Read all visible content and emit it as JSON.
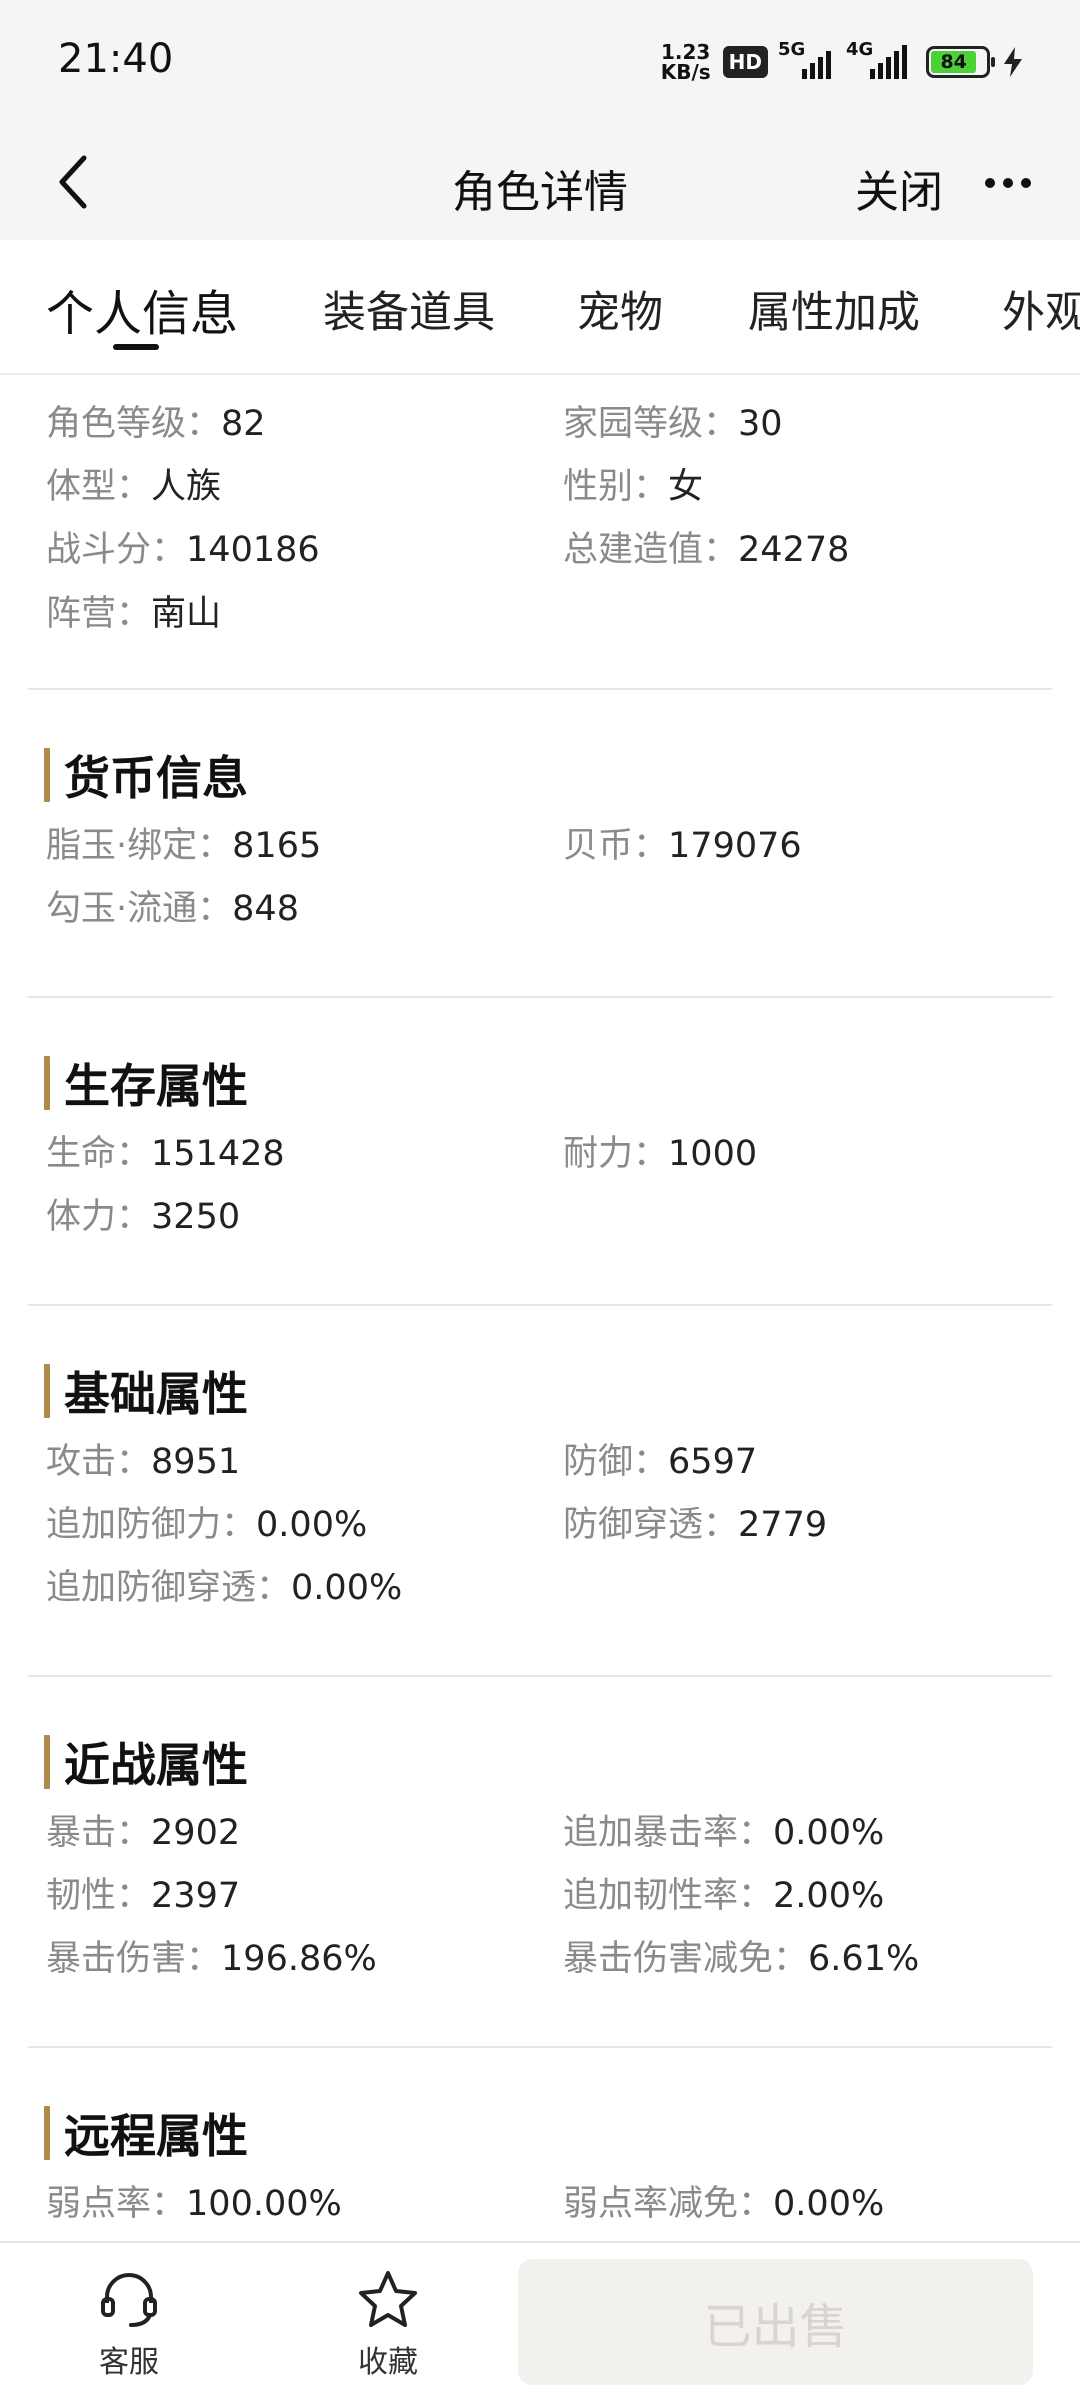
{
  "status_bar": {
    "time": "21:40",
    "net_speed_value": "1.23",
    "net_speed_unit": "KB/s",
    "hd_label": "HD",
    "sig1_label": "5G",
    "sig2_label": "4G",
    "battery_level": "84",
    "icons": [
      "hd-icon",
      "signal-5g-icon",
      "signal-4g-icon",
      "battery-icon",
      "charging-bolt-icon"
    ]
  },
  "nav": {
    "title": "角色详情",
    "close_label": "关闭",
    "icons": [
      "back-chevron-icon",
      "more-dots-icon"
    ]
  },
  "tabs": [
    {
      "label": "个人信息",
      "active": true
    },
    {
      "label": "装备道具"
    },
    {
      "label": "宠物"
    },
    {
      "label": "属性加成"
    },
    {
      "label": "外观"
    }
  ],
  "separator": "：",
  "personal": {
    "items": [
      {
        "key": "角色等级",
        "value": "82"
      },
      {
        "key": "家园等级",
        "value": "30"
      },
      {
        "key": "体型",
        "value": "人族"
      },
      {
        "key": "性别",
        "value": "女"
      },
      {
        "key": "战斗分",
        "value": "140186"
      },
      {
        "key": "总建造值",
        "value": "24278"
      },
      {
        "key": "阵营",
        "value": "南山"
      }
    ]
  },
  "currency": {
    "title": "货币信息",
    "items": [
      {
        "key": "脂玉·绑定",
        "value": "8165"
      },
      {
        "key": "贝币",
        "value": "179076"
      },
      {
        "key": "勾玉·流通",
        "value": "848"
      }
    ]
  },
  "survival": {
    "title": "生存属性",
    "items": [
      {
        "key": "生命",
        "value": "151428"
      },
      {
        "key": "耐力",
        "value": "1000"
      },
      {
        "key": "体力",
        "value": "3250"
      }
    ]
  },
  "basic": {
    "title": "基础属性",
    "items": [
      {
        "key": "攻击",
        "value": "8951"
      },
      {
        "key": "防御",
        "value": "6597"
      },
      {
        "key": "追加防御力",
        "value": "0.00%"
      },
      {
        "key": "防御穿透",
        "value": "2779"
      },
      {
        "key": "追加防御穿透",
        "value": "0.00%"
      }
    ]
  },
  "melee": {
    "title": "近战属性",
    "items": [
      {
        "key": "暴击",
        "value": "2902"
      },
      {
        "key": "追加暴击率",
        "value": "0.00%"
      },
      {
        "key": "韧性",
        "value": "2397"
      },
      {
        "key": "追加韧性率",
        "value": "2.00%"
      },
      {
        "key": "暴击伤害",
        "value": "196.86%"
      },
      {
        "key": "暴击伤害减免",
        "value": "6.61%"
      }
    ]
  },
  "ranged": {
    "title": "远程属性",
    "items": [
      {
        "key": "弱点率",
        "value": "100.00%"
      },
      {
        "key": "弱点率减免",
        "value": "0.00%"
      }
    ]
  },
  "bottom_bar": {
    "service_label": "客服",
    "favorite_label": "收藏",
    "sold_label": "已出售",
    "icons": [
      "headset-icon",
      "star-icon"
    ]
  }
}
